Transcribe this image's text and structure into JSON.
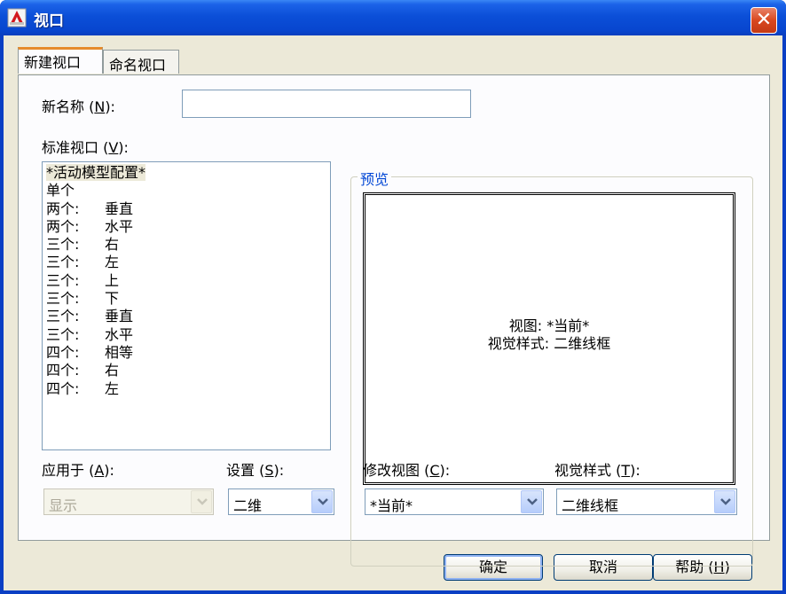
{
  "window": {
    "title": "视口"
  },
  "tabs": [
    {
      "label": "新建视口"
    },
    {
      "label": "命名视口"
    }
  ],
  "new_name": {
    "label": "新名称",
    "mnemonic": "N",
    "value": ""
  },
  "standard_viewports": {
    "label": "标准视口",
    "mnemonic": "V",
    "items": [
      {
        "count": "*活动模型配置*",
        "layout": ""
      },
      {
        "count": "单个",
        "layout": ""
      },
      {
        "count": "两个:",
        "layout": "垂直"
      },
      {
        "count": "两个:",
        "layout": "水平"
      },
      {
        "count": "三个:",
        "layout": "右"
      },
      {
        "count": "三个:",
        "layout": "左"
      },
      {
        "count": "三个:",
        "layout": "上"
      },
      {
        "count": "三个:",
        "layout": "下"
      },
      {
        "count": "三个:",
        "layout": "垂直"
      },
      {
        "count": "三个:",
        "layout": "水平"
      },
      {
        "count": "四个:",
        "layout": "相等"
      },
      {
        "count": "四个:",
        "layout": "右"
      },
      {
        "count": "四个:",
        "layout": "左"
      }
    ]
  },
  "preview": {
    "title": "预览",
    "view_line": "视图: *当前*",
    "style_line": "视觉样式: 二维线框"
  },
  "apply_to": {
    "label": "应用于",
    "mnemonic": "A",
    "value": "显示"
  },
  "setup": {
    "label": "设置",
    "mnemonic": "S",
    "value": "二维"
  },
  "change_view": {
    "label": "修改视图",
    "mnemonic": "C",
    "value": "*当前*"
  },
  "visual_style": {
    "label": "视觉样式",
    "mnemonic": "T",
    "value": "二维线框"
  },
  "buttons": {
    "ok": "确定",
    "cancel": "取消",
    "help": "帮助",
    "help_mnemonic": "H"
  },
  "colors": {
    "title_bar": "#0b4fd8",
    "dialog_face": "#ece9d8",
    "group_title": "#0046d5",
    "close_button": "#d9481f"
  }
}
